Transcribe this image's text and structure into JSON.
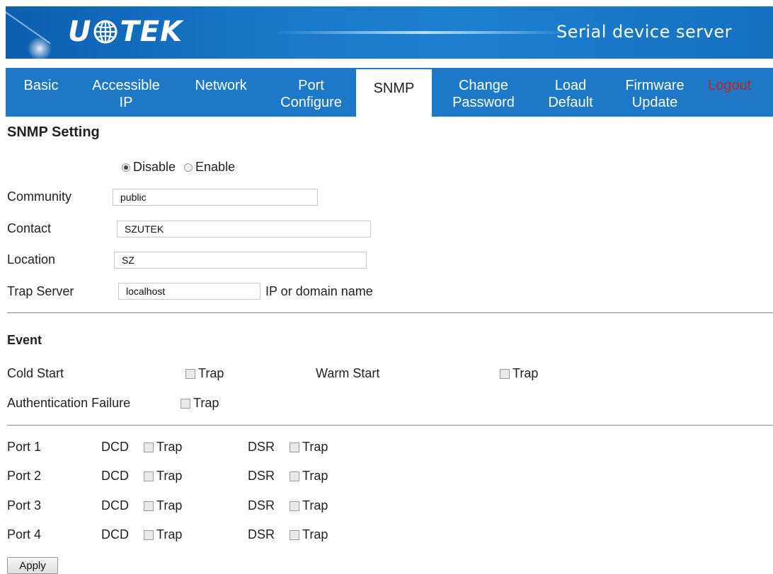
{
  "header": {
    "logo_text_left": "U",
    "logo_text_right": "TEK",
    "title": "Serial device server"
  },
  "nav": [
    {
      "label_1": "Basic",
      "label_2": ""
    },
    {
      "label_1": "Accessible",
      "label_2": "IP"
    },
    {
      "label_1": "Network",
      "label_2": ""
    },
    {
      "label_1": "Port",
      "label_2": "Configure"
    },
    {
      "label_1": "SNMP",
      "label_2": ""
    },
    {
      "label_1": "Change",
      "label_2": "Password"
    },
    {
      "label_1": "Load",
      "label_2": "Default"
    },
    {
      "label_1": "Firmware",
      "label_2": "Update"
    },
    {
      "label_1": "Logout",
      "label_2": ""
    }
  ],
  "snmp": {
    "heading": "SNMP Setting",
    "disable_label": "Disable",
    "enable_label": "Enable",
    "selected": "Disable",
    "community_label": "Community",
    "community_value": "public",
    "contact_label": "Contact",
    "contact_value": "SZUTEK",
    "location_label": "Location",
    "location_value": "SZ",
    "trap_server_label": "Trap Server",
    "trap_server_value": "localhost",
    "trap_server_hint": "IP or domain name"
  },
  "event": {
    "heading": "Event",
    "cold_start": "Cold Start",
    "warm_start": "Warm Start",
    "auth_failure": "Authentication Failure",
    "trap_label": "Trap"
  },
  "ports": {
    "dcd_label": "DCD",
    "dsr_label": "DSR",
    "trap_label": "Trap",
    "items": [
      "Port 1",
      "Port 2",
      "Port 3",
      "Port 4"
    ]
  },
  "apply_label": "Apply",
  "colors": {
    "nav_bg": "#1d79c8",
    "logout": "#c0241b"
  }
}
